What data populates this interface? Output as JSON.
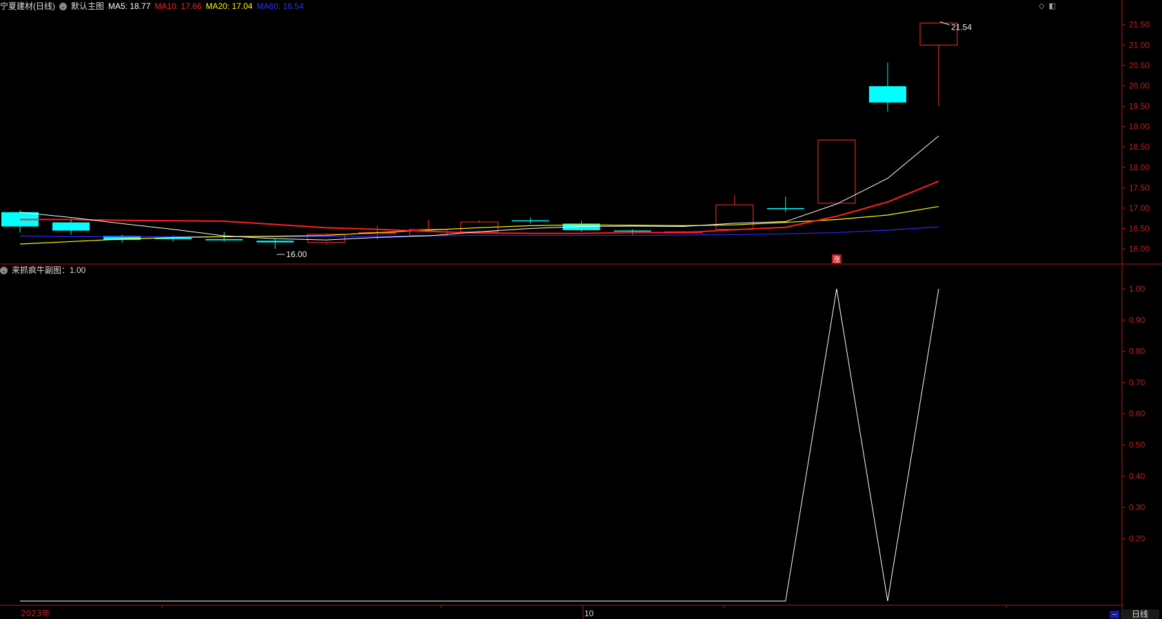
{
  "main_header": {
    "stock_name": "宁夏建材(日线)",
    "main_label": "默认主图",
    "ma5_label": "MA5: 18.77",
    "ma10_label": "MA10: 17.66",
    "ma20_label": "MA20: 17.04",
    "ma60_label": "MA60: 16.54",
    "colors": {
      "ma5": "#ffffff",
      "ma10": "#ff2020",
      "ma20": "#ffff00",
      "ma60": "#2020ff"
    }
  },
  "sub_header": {
    "label": "来抓疯牛副图：1.00"
  },
  "icons": [
    "diamond-icon",
    "window-toggle-icon",
    "collapse-icon"
  ],
  "x_axis": {
    "labels": [
      "2023年",
      "10"
    ]
  },
  "period_button": "日线",
  "mini_indicator": "--",
  "price_annotations": {
    "high": "21.54",
    "low": "16.00",
    "marker": "涨"
  },
  "chart_data": [
    {
      "type": "candlestick",
      "y_ticks": [
        "16.00",
        "16.50",
        "17.00",
        "17.50",
        "18.00",
        "18.50",
        "19.00",
        "19.50",
        "20.00",
        "20.50",
        "21.00",
        "21.50"
      ],
      "ylim": [
        15.9,
        21.8
      ],
      "candles": [
        {
          "o": 16.9,
          "c": 16.55,
          "h": 16.95,
          "l": 16.4
        },
        {
          "o": 16.65,
          "c": 16.45,
          "h": 16.75,
          "l": 16.35
        },
        {
          "o": 16.32,
          "c": 16.22,
          "h": 16.35,
          "l": 16.15
        },
        {
          "o": 16.27,
          "c": 16.24,
          "h": 16.33,
          "l": 16.18
        },
        {
          "o": 16.24,
          "c": 16.21,
          "h": 16.42,
          "l": 16.18
        },
        {
          "o": 16.2,
          "c": 16.16,
          "h": 16.26,
          "l": 16.0
        },
        {
          "o": 16.16,
          "c": 16.36,
          "h": 16.38,
          "l": 16.1
        },
        {
          "o": 16.38,
          "c": 16.4,
          "h": 16.57,
          "l": 16.23
        },
        {
          "o": 16.33,
          "c": 16.48,
          "h": 16.72,
          "l": 16.33
        },
        {
          "o": 16.42,
          "c": 16.66,
          "h": 16.7,
          "l": 16.38
        },
        {
          "o": 16.7,
          "c": 16.69,
          "h": 16.77,
          "l": 16.63
        },
        {
          "o": 16.62,
          "c": 16.46,
          "h": 16.69,
          "l": 16.42
        },
        {
          "o": 16.45,
          "c": 16.43,
          "h": 16.48,
          "l": 16.35
        },
        {
          "o": 16.4,
          "c": 16.42,
          "h": 16.44,
          "l": 16.4
        },
        {
          "o": 16.48,
          "c": 17.08,
          "h": 17.32,
          "l": 16.47
        },
        {
          "o": 17.0,
          "c": 16.99,
          "h": 17.28,
          "l": 16.9
        },
        {
          "o": 17.12,
          "c": 18.67,
          "h": 18.67,
          "l": 17.12
        },
        {
          "o": 19.99,
          "c": 19.59,
          "h": 20.57,
          "l": 19.37
        },
        {
          "o": 21.0,
          "c": 21.54,
          "h": 21.54,
          "l": 19.5
        }
      ],
      "ma5": [
        16.9,
        16.77,
        16.62,
        16.48,
        16.32,
        16.25,
        16.22,
        16.28,
        16.32,
        16.42,
        16.5,
        16.55,
        16.56,
        16.55,
        16.63,
        16.67,
        17.1,
        17.73,
        18.77
      ],
      "ma10": [
        16.72,
        16.72,
        16.7,
        16.69,
        16.68,
        16.6,
        16.52,
        16.48,
        16.43,
        16.39,
        16.38,
        16.38,
        16.4,
        16.4,
        16.47,
        16.53,
        16.8,
        17.15,
        17.66
      ],
      "ma20": [
        16.12,
        16.18,
        16.24,
        16.28,
        16.3,
        16.31,
        16.33,
        16.4,
        16.46,
        16.52,
        16.57,
        16.59,
        16.58,
        16.57,
        16.59,
        16.65,
        16.72,
        16.83,
        17.04
      ],
      "ma60": [
        16.32,
        16.3,
        16.3,
        16.3,
        16.3,
        16.3,
        16.3,
        16.31,
        16.32,
        16.33,
        16.33,
        16.33,
        16.33,
        16.34,
        16.35,
        16.37,
        16.4,
        16.46,
        16.54
      ]
    },
    {
      "type": "line",
      "series": [
        {
          "values": [
            0,
            0,
            0,
            0,
            0,
            0,
            0,
            0,
            0,
            0,
            0,
            0,
            0,
            0,
            0,
            0,
            1,
            0,
            1
          ]
        }
      ],
      "y_ticks": [
        "0.20",
        "0.30",
        "0.40",
        "0.50",
        "0.60",
        "0.70",
        "0.80",
        "0.90",
        "1.00"
      ],
      "ylim": [
        0,
        1
      ]
    }
  ]
}
